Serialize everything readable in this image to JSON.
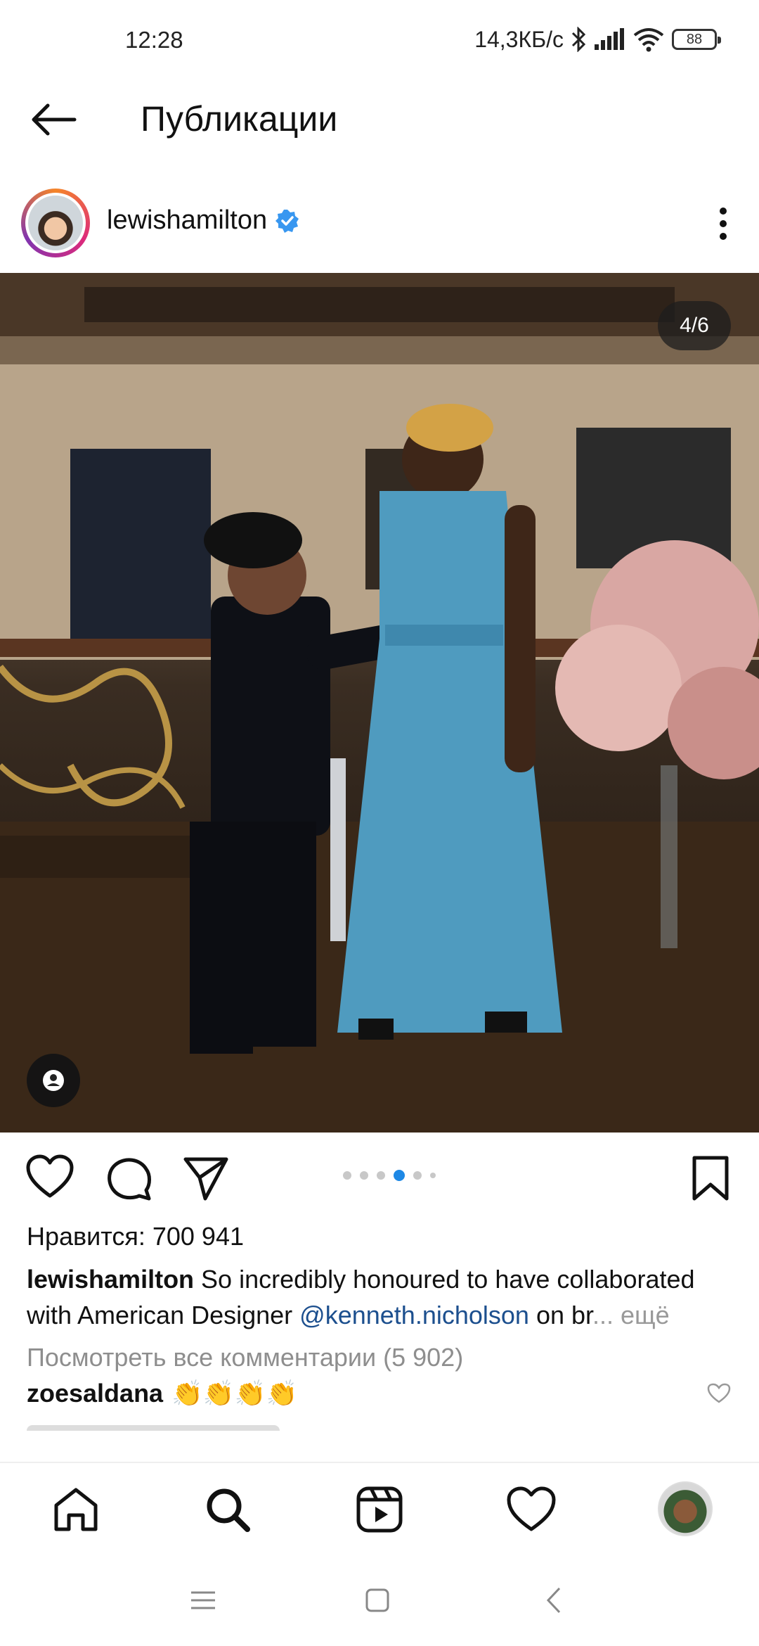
{
  "status_bar": {
    "time": "12:28",
    "network_speed": "14,3КБ/с",
    "battery": "88"
  },
  "header": {
    "title": "Публикации"
  },
  "post": {
    "username": "lewishamilton",
    "carousel_position": "4/6",
    "likes": "Нравится: 700 941",
    "caption_user": "lewishamilton",
    "caption_text_1": " So incredibly honoured to have collaborated with American Designer ",
    "caption_mention": "@kenneth.nicholson",
    "caption_text_2": " on br",
    "caption_more": "... ещё",
    "view_comments": "Посмотреть все комментарии (5 902)",
    "comment_user": "zoesaldana",
    "comment_text": "👏👏👏👏"
  },
  "icons": {
    "back": "arrow-left-icon",
    "verified": "verified-badge-icon",
    "more": "more-vertical-icon",
    "like": "heart-icon",
    "comment": "comment-icon",
    "share": "send-icon",
    "save": "bookmark-icon",
    "home": "home-icon",
    "search": "search-icon",
    "reels": "reels-icon",
    "activity": "heart-icon"
  },
  "colors": {
    "accent": "#1e88e5",
    "mention": "#1c4f8e",
    "verified": "#3897f0"
  }
}
